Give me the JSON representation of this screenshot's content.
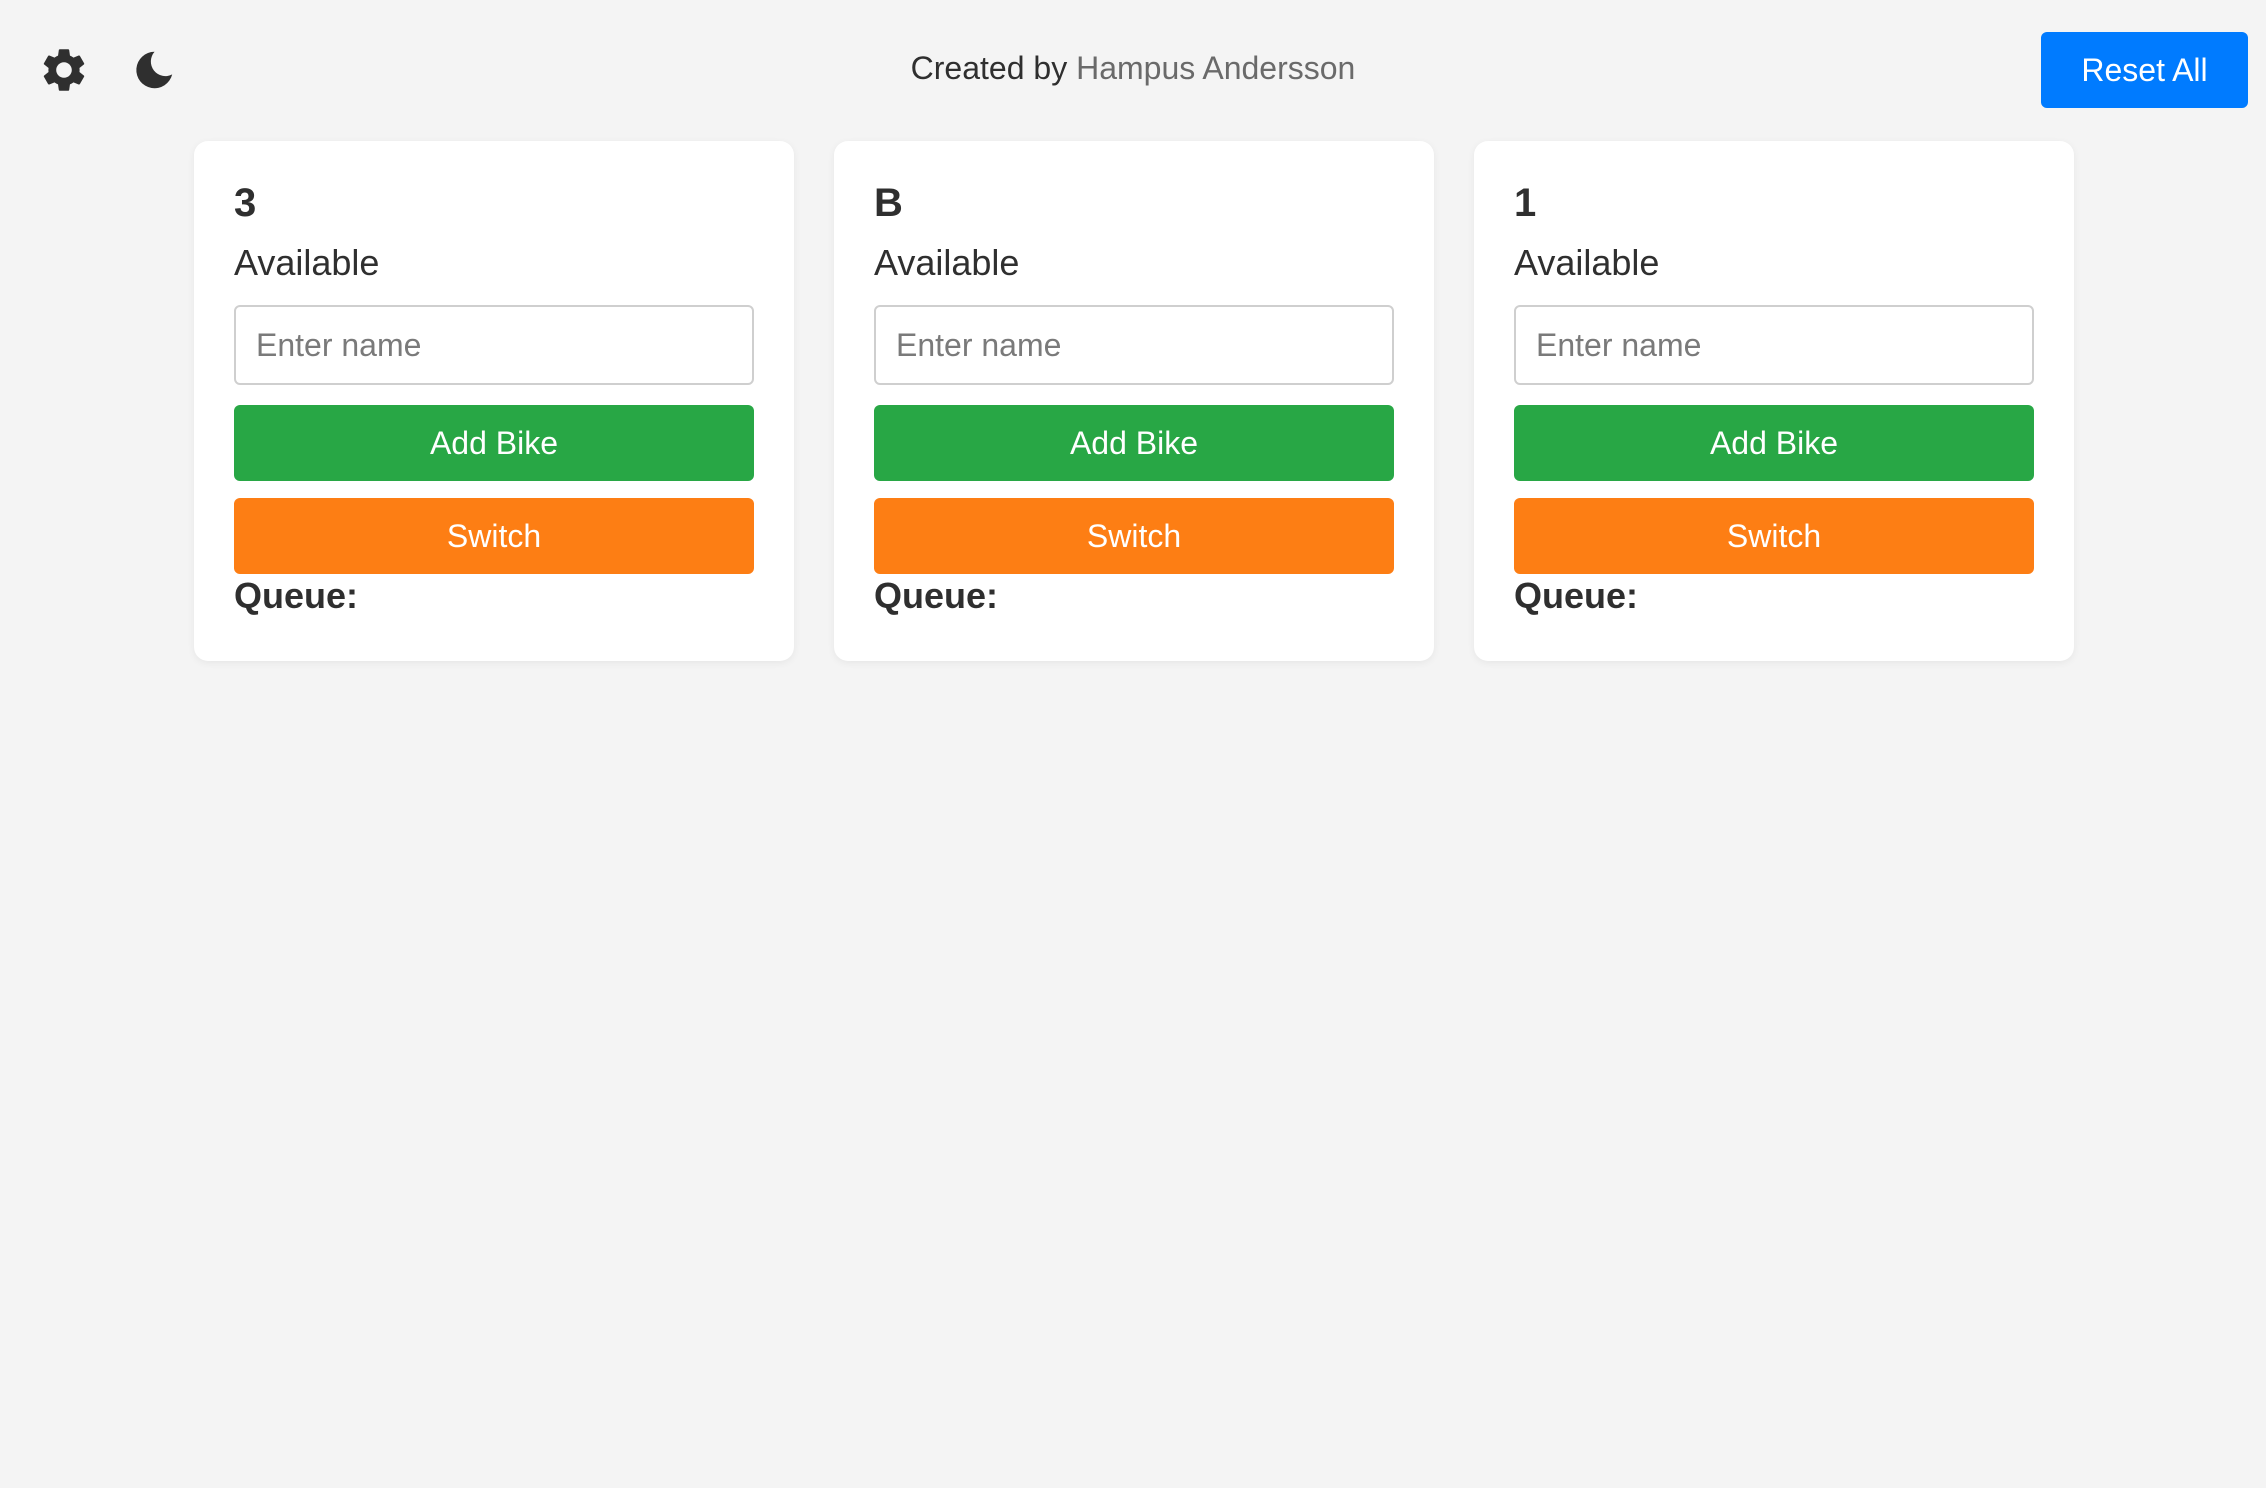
{
  "header": {
    "settings_icon": "gear-icon",
    "theme_icon": "moon-icon",
    "credit_prefix": "Created by ",
    "credit_author": "Hampus Andersson",
    "reset_label": "Reset All",
    "reset_color": "#007bff"
  },
  "colors": {
    "background": "#f4f4f4",
    "add_button": "#28a745",
    "switch_button": "#fd7e14"
  },
  "stations": [
    {
      "id": "3",
      "status": "Available",
      "input_placeholder": "Enter name",
      "input_value": "",
      "add_label": "Add Bike",
      "switch_label": "Switch",
      "queue_label": "Queue:",
      "queue": []
    },
    {
      "id": "B",
      "status": "Available",
      "input_placeholder": "Enter name",
      "input_value": "",
      "add_label": "Add Bike",
      "switch_label": "Switch",
      "queue_label": "Queue:",
      "queue": []
    },
    {
      "id": "1",
      "status": "Available",
      "input_placeholder": "Enter name",
      "input_value": "",
      "add_label": "Add Bike",
      "switch_label": "Switch",
      "queue_label": "Queue:",
      "queue": []
    }
  ]
}
